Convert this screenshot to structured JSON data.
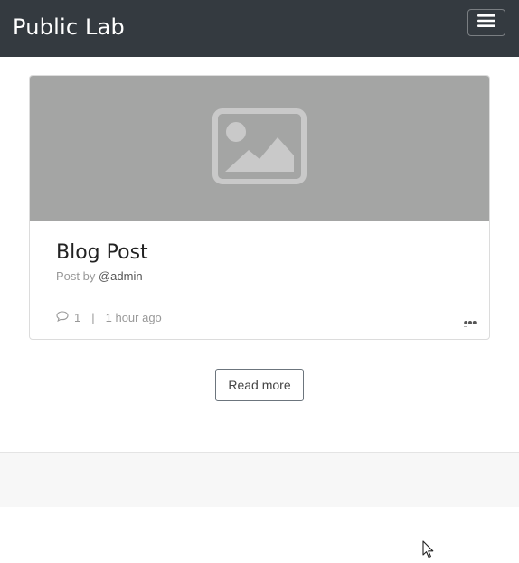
{
  "navbar": {
    "brand": "Public Lab",
    "menu_icon": "hamburger-menu-icon"
  },
  "post": {
    "image_icon": "image-placeholder-icon",
    "title": "Blog Post",
    "byline_prefix": "Post by",
    "author": "@admin",
    "comment_icon": "comment-icon",
    "comment_count": "1",
    "separator": "|",
    "time_ago": "1 hour ago",
    "more_icon": "more-options-icon"
  },
  "actions": {
    "read_more_label": "Read more"
  },
  "colors": {
    "navbar_bg": "#343a40",
    "image_bg": "#a4a5a4",
    "footer_bg": "#f7f7f7"
  }
}
